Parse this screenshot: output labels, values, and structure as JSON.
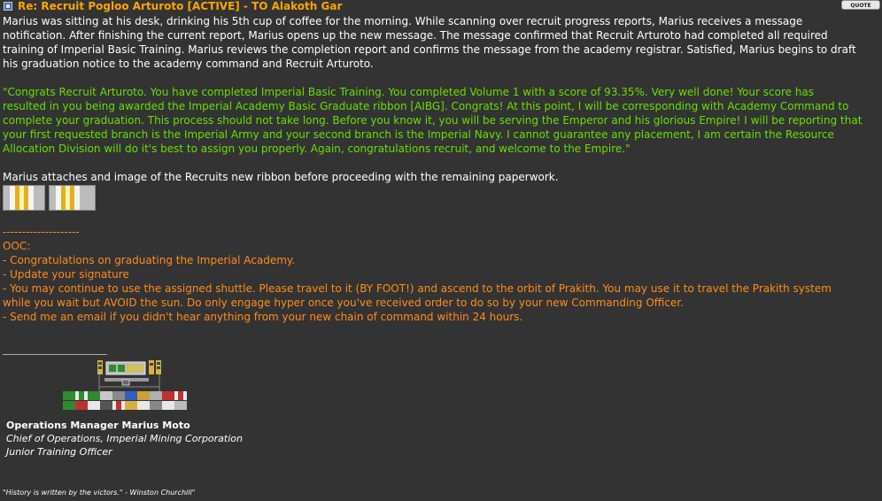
{
  "post": {
    "title": "Re: Recruit Pogloo Arturoto [ACTIVE] - TO Alakoth Gar",
    "quote_label": "QUOTE"
  },
  "narrative": "Marius was sitting at his desk, drinking his 5th cup of coffee for the morning. While scanning over recruit progress reports, Marius receives a message\nnotification. After finishing the current report, Marius opens up the new message. The message confirmed that Recruit Arturoto had completed all required\ntraining of Imperial Basic Training. Marius reviews the completion report and confirms the message from the academy registrar. Satisfied, Marius begins to draft\nhis graduation notice to the academy command and Recruit Arturoto.",
  "message": "\"Congrats Recruit Arturoto. You have completed Imperial Basic Training. You completed Volume 1 with a score of 93.35%. Very well done! Your score has\nresulted in you being awarded the Imperial Academy Basic Graduate ribbon [AIBG]. Congrats! At this point, I will be corresponding with Academy Command to\ncomplete your graduation. This process should not take long. Before you know it, you will be serving the Emperor and his glorious Empire! I will be reporting that\nyour first requested branch is the Imperial Army and your second branch is the Imperial Navy. I cannot guarantee any placement, I am certain the Resource\nAllocation Division will do it's best to assign you properly. Again, congratulations recruit, and welcome to the Empire.\"",
  "attachment_note": "Marius attaches and image of the Recruits new ribbon before proceeding with the remaining paperwork.",
  "ooc": {
    "separator": "--------------------",
    "heading": "OOC:",
    "items": [
      "- Congratulations on graduating the Imperial Academy.",
      "- Update your signature",
      "- You may continue to use the assigned shuttle. Please travel to it (BY FOOT!) and ascend to the orbit of Prakith. You may use it to travel the Prakith system\nwhile you wait but AVOID the sun. Do only engage hyper once you've received order to do so by your new Commanding Officer.",
      "- Send me an email if you didn't hear anything from your new chain of command within 24 hours."
    ]
  },
  "signature": {
    "name": "Operations Manager Marius Moto",
    "role1": "Chief of Operations, Imperial Mining Corporation",
    "role2": "Junior Training Officer",
    "quote": "\"History is written by the victors.\" - Winston Churchill\""
  },
  "colors": {
    "background": "#333333",
    "title": "#ffa500",
    "message_green": "#66e000",
    "ooc_orange": "#ff8c1a"
  }
}
